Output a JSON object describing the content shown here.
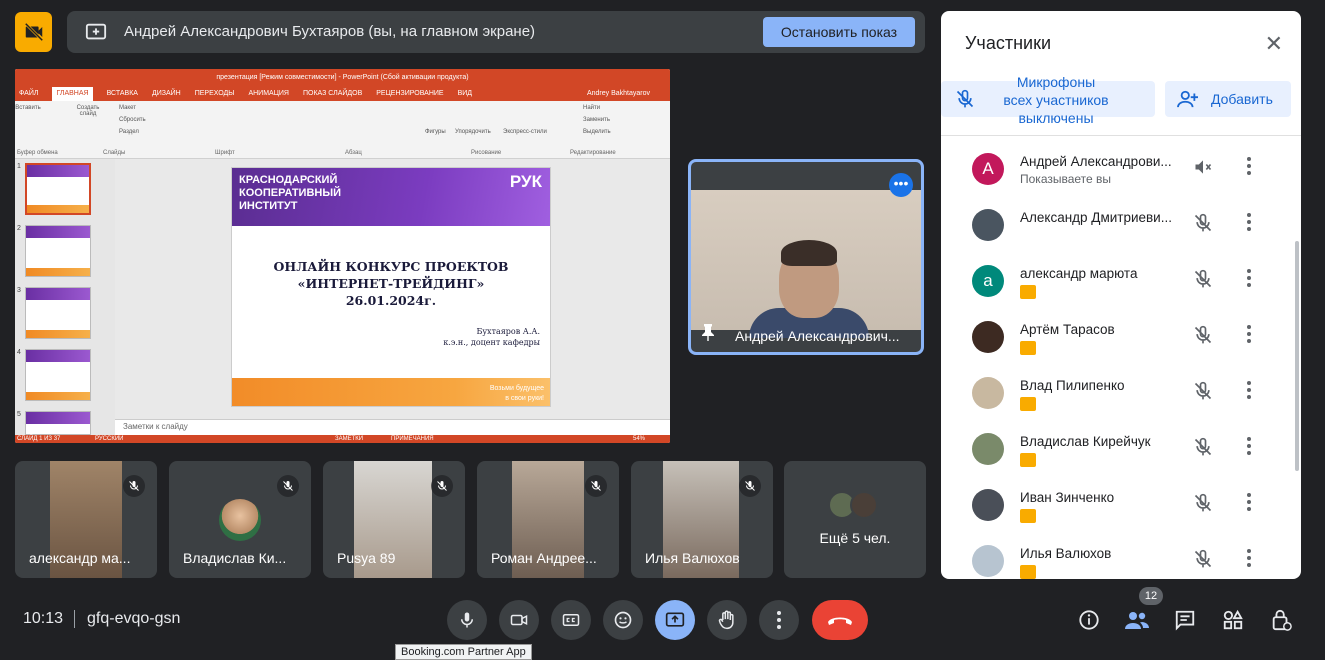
{
  "banner": {
    "presenting_text": "Андрей Александрович Бухтаяров (вы, на главном экране)",
    "stop_label": "Остановить показ"
  },
  "shared_screen": {
    "window_title": "презентация [Режим совместимости] - PowerPoint (Сбой активации продукта)",
    "tabs": [
      "ФАЙЛ",
      "ГЛАВНАЯ",
      "ВСТАВКА",
      "ДИЗАЙН",
      "ПЕРЕХОДЫ",
      "АНИМАЦИЯ",
      "ПОКАЗ СЛАЙДОВ",
      "РЕЦЕНЗИРОВАНИЕ",
      "ВИД"
    ],
    "user": "Andrey Bakhtayarov",
    "ribbon_groups": [
      "Буфер обмена",
      "Слайды",
      "Шрифт",
      "Абзац",
      "Рисование",
      "Редактирование"
    ],
    "ribbon_items": {
      "layout": "Макет",
      "reset": "Сбросить",
      "section": "Раздел",
      "find": "Найти",
      "replace": "Заменить",
      "select": "Выделить",
      "paste": "Вставить",
      "new_slide": "Создать слайд",
      "shapes": "Фигуры",
      "arrange": "Упорядочить",
      "quick_styles": "Экспресс-стили"
    },
    "slide_numbers": [
      "1",
      "2",
      "3",
      "4",
      "5"
    ],
    "slide": {
      "institute": "КРАСНОДАРСКИЙ КООПЕРАТИВНЫЙ ИНСТИТУТ",
      "logo": "РУК",
      "title_line1": "ОНЛАЙН КОНКУРС ПРОЕКТОВ",
      "title_line2": "«ИНТЕРНЕТ-ТРЕЙДИНГ»",
      "title_line3": "26.01.2024г.",
      "author": "Бухтаяров А.А.",
      "author_role": "к.э.н., доцент кафедры",
      "slogan_line1": "Возьми будущее",
      "slogan_line2": "в свои руки!"
    },
    "notes_placeholder": "Заметки к слайду",
    "status": {
      "slide_counter": "СЛАЙД 1 ИЗ 37",
      "language": "РУССКИЙ",
      "notes": "ЗАМЕТКИ",
      "comments": "ПРИМЕЧАНИЯ",
      "zoom": "54%"
    }
  },
  "pinned_tile": {
    "name": "Андрей Александрович..."
  },
  "tiles": [
    {
      "label": "александр ма..."
    },
    {
      "label": "Владислав Ки..."
    },
    {
      "label": "Pusya 89"
    },
    {
      "label": "Роман Андрее..."
    },
    {
      "label": "Илья Валюхов"
    },
    {
      "label": "Ещё 5 чел."
    }
  ],
  "panel": {
    "title": "Участники",
    "mute_all": "Микрофоны всех участников выключены",
    "add": "Добавить",
    "participants": [
      {
        "name": "Андрей Александрови...",
        "sub": "Показываете вы",
        "initial": "А",
        "color": "#c2185b"
      },
      {
        "name": "Александр Дмитриеви...",
        "sub": "",
        "initial": "",
        "color": "#4a5560"
      },
      {
        "name": "александр марюта",
        "sub": "",
        "initial": "а",
        "color": "#00897b"
      },
      {
        "name": "Артём Тарасов",
        "sub": "",
        "initial": "",
        "color": "#3d2a22"
      },
      {
        "name": "Влад Пилипенко",
        "sub": "",
        "initial": "",
        "color": "#c8b8a0"
      },
      {
        "name": "Владислав Кирейчук",
        "sub": "",
        "initial": "",
        "color": "#7a8a6a"
      },
      {
        "name": "Иван Зинченко",
        "sub": "",
        "initial": "",
        "color": "#4a4f58"
      },
      {
        "name": "Илья Валюхов",
        "sub": "",
        "initial": "",
        "color": "#b7c4d0"
      }
    ]
  },
  "bottom_bar": {
    "time": "10:13",
    "meeting_code": "gfq-evqo-gsn",
    "participant_count": "12",
    "tooltip": "Booking.com Partner App"
  }
}
